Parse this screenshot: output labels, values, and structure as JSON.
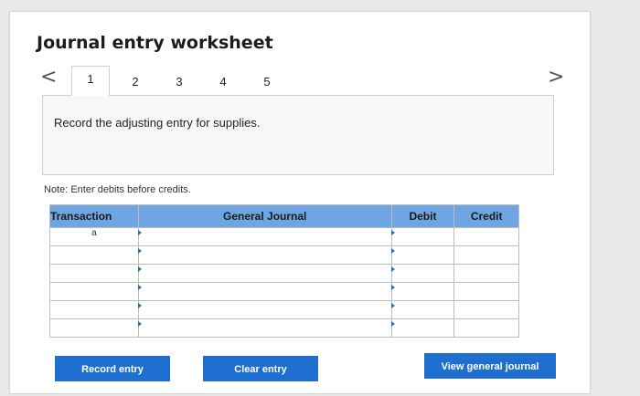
{
  "worksheet": {
    "title": "Journal entry worksheet",
    "tabs": [
      "1",
      "2",
      "3",
      "4",
      "5"
    ],
    "active_tab": "1",
    "instruction": "Record the adjusting entry for supplies.",
    "note": "Note: Enter debits before credits."
  },
  "nav": {
    "prev": "<",
    "next": ">"
  },
  "table": {
    "headers": [
      "Transaction",
      "General Journal",
      "Debit",
      "Credit"
    ],
    "rows": [
      {
        "transaction": "a"
      },
      {
        "transaction": ""
      },
      {
        "transaction": ""
      },
      {
        "transaction": ""
      },
      {
        "transaction": ""
      },
      {
        "transaction": ""
      }
    ]
  },
  "buttons": {
    "record": "Record entry",
    "clear": "Clear entry",
    "view": "View general journal"
  },
  "colors": {
    "header_bg": "#6ea6e4",
    "button_bg": "#1f6fd1"
  }
}
